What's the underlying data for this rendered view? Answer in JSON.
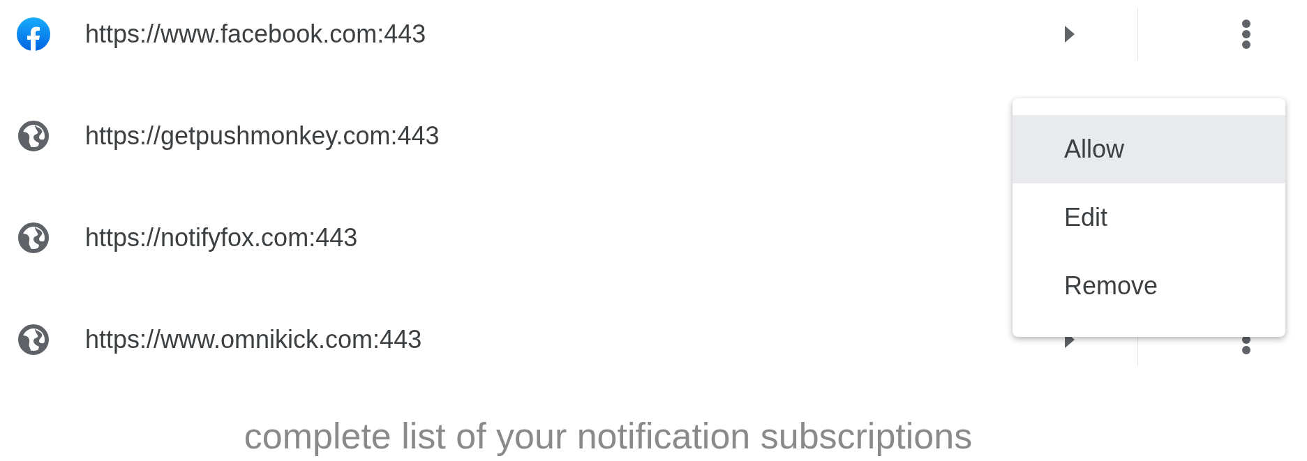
{
  "sites": [
    {
      "kind": "brand",
      "url": "https://www.facebook.com:443"
    },
    {
      "kind": "generic",
      "url": "https://getpushmonkey.com:443"
    },
    {
      "kind": "generic",
      "url": "https://notifyfox.com:443"
    },
    {
      "kind": "generic",
      "url": "https://www.omnikick.com:443"
    }
  ],
  "menu": {
    "items": [
      {
        "label": "Allow",
        "selected": true
      },
      {
        "label": "Edit",
        "selected": false
      },
      {
        "label": "Remove",
        "selected": false
      }
    ]
  },
  "caption": "complete list of your notification subscriptions"
}
